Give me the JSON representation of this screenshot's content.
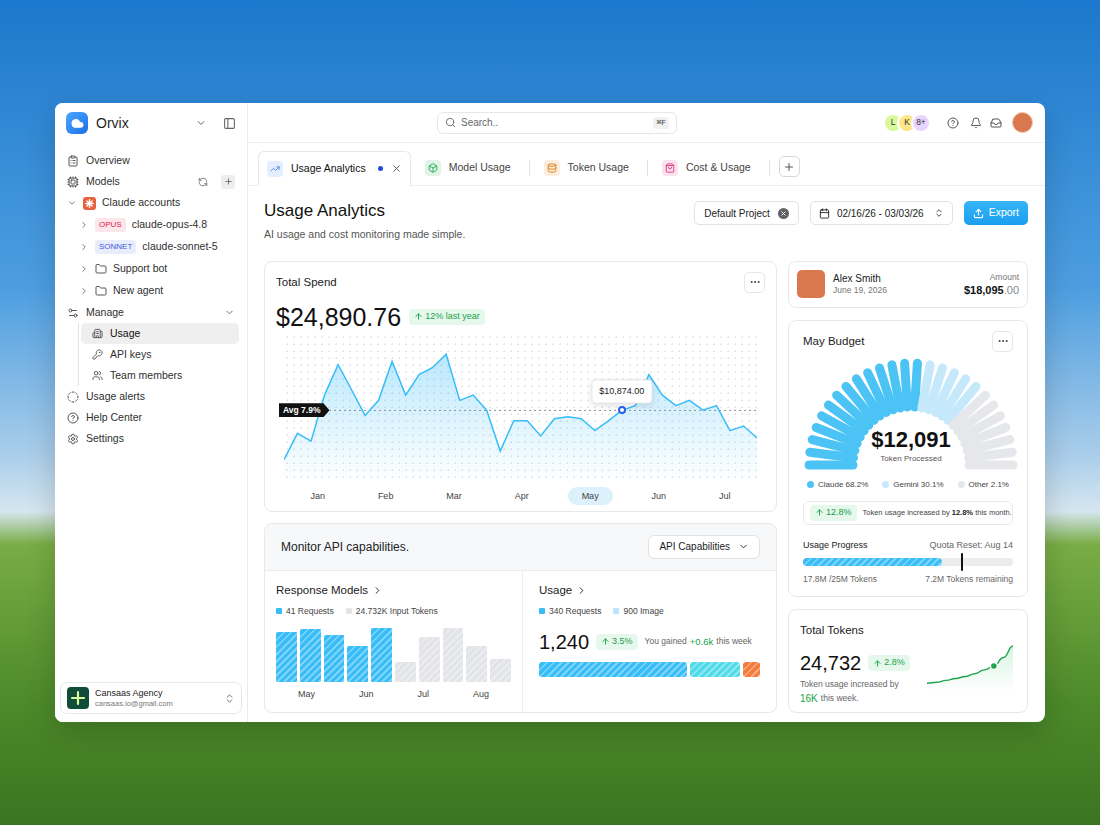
{
  "sidebar": {
    "brand": "Orvix",
    "overview": "Overview",
    "models": {
      "label": "Models",
      "group": {
        "label": "Claude accounts",
        "expanded": true,
        "children": [
          {
            "label": "claude-opus-4.8",
            "kind": "model",
            "badge": "OPUS",
            "color": "#e11d48",
            "expanded": false
          },
          {
            "label": "claude-sonnet-5",
            "kind": "model",
            "badge": "SONNET",
            "color": "#3b5bdb",
            "expanded": false
          },
          {
            "label": "Support bot",
            "kind": "folder",
            "expanded": false
          },
          {
            "label": "New agent",
            "kind": "folder",
            "expanded": false
          }
        ]
      }
    },
    "manage": {
      "label": "Manage",
      "expanded": true,
      "children": [
        {
          "label": "Usage",
          "selected": true
        },
        {
          "label": "API keys",
          "selected": false
        },
        {
          "label": "Team members",
          "selected": false
        }
      ]
    },
    "links": [
      "Usage alerts",
      "Help Center",
      "Settings"
    ],
    "account": {
      "name": "Cansaas Agency",
      "email": "cansaas.io@gmail.com"
    }
  },
  "topbar": {
    "search": {
      "placeholder": "Search..",
      "shortcut": "⌘F"
    },
    "avatars": [
      {
        "label": "L",
        "color": "#d9f99d"
      },
      {
        "label": "K",
        "color": "#fde68a"
      },
      {
        "label": "8+",
        "color": "#e9d5ff"
      }
    ]
  },
  "tabs": [
    {
      "label": "Usage Analytics",
      "selected": true,
      "modified": true,
      "color": "#3b82f6"
    },
    {
      "label": "Model Usage",
      "selected": false,
      "modified": false,
      "color": "#16a34a"
    },
    {
      "label": "Token Usage",
      "selected": false,
      "modified": false,
      "color": "#d97706"
    },
    {
      "label": "Cost & Usage",
      "selected": false,
      "modified": false,
      "color": "#db2777"
    }
  ],
  "page": {
    "title": "Usage Analytics",
    "subtitle": "AI usage and cost monitoring made simple.",
    "project": "Default Project",
    "date_range": "02/16/26 - 03/03/26",
    "export": "Export"
  },
  "total_spend": {
    "title": "Total Spend",
    "amount": "$24,890.76",
    "change": "12% last year",
    "chart": {
      "values": [
        3400,
        7400,
        6200,
        13200,
        17800,
        14000,
        10100,
        12400,
        18300,
        13200,
        16300,
        17400,
        19400,
        12400,
        13200,
        10900,
        4700,
        9300,
        9300,
        7000,
        9600,
        9900,
        9600,
        7800,
        9300,
        10874,
        11600,
        16300,
        13200,
        11600,
        12400,
        10900,
        11600,
        7800,
        8500,
        6700
      ],
      "avg_label": "Avg 7.9%",
      "avg_value": 10874,
      "tooltip": {
        "index": 25,
        "label": "$10,874.00"
      },
      "months": [
        {
          "label": "Jan",
          "selected": false
        },
        {
          "label": "Feb",
          "selected": false
        },
        {
          "label": "Mar",
          "selected": false
        },
        {
          "label": "Apr",
          "selected": false
        },
        {
          "label": "May",
          "selected": true
        },
        {
          "label": "Jun",
          "selected": false
        },
        {
          "label": "Jul",
          "selected": false
        }
      ]
    }
  },
  "monitor": {
    "title": "Monitor API capabilities.",
    "dropdown": "API Capabilities",
    "response_models": {
      "title": "Response Models",
      "series": [
        {
          "label": "41 Requests",
          "color": "#38bdf8",
          "values": [
            50,
            53,
            47,
            36,
            54
          ]
        },
        {
          "label": "24.732K Input Tokens",
          "color": "#e2e4e8",
          "values": [
            20,
            45,
            54,
            36,
            23
          ]
        }
      ],
      "months": [
        "May",
        "Jun",
        "Jul",
        "Aug"
      ]
    },
    "usage": {
      "title": "Usage",
      "legend": [
        {
          "label": "340 Requests",
          "color": "#38bdf8"
        },
        {
          "label": "900 Image",
          "color": "#bae6fd"
        }
      ],
      "value": "1,240",
      "change": "3.5%",
      "note_prefix": "You gained",
      "note_gain": "+0.6k",
      "note_suffix": "this week",
      "segments": [
        {
          "level": 0.68,
          "color": "#38bdf8"
        },
        {
          "level": 0.23,
          "color": "#4fdbe8"
        },
        {
          "level": 0.08,
          "color": "#f47b3a"
        }
      ]
    }
  },
  "transaction": {
    "name": "Alex Smith",
    "date": "June 19, 2026",
    "amount_label": "Amount",
    "amount": "$18,095",
    "amount_cents": ".00"
  },
  "budget": {
    "title": "May Budget",
    "value": "$12,091",
    "caption": "Token Processed",
    "legend": [
      {
        "label": "Claude 68.2%",
        "color": "#4cc3f5",
        "level": 0.52
      },
      {
        "label": "Gemini 30.1%",
        "color": "#c5e9fb",
        "level": 0.2
      },
      {
        "label": "Other 2.1%",
        "color": "#e6e7ea",
        "level": 0.28
      }
    ],
    "change": "12.8%",
    "note_prefix": "Token usage increased by ",
    "note_value": "12.8%",
    "note_suffix": " this month.",
    "progress": {
      "label": "Usage Progress",
      "reset": "Quota Reset: Aug 14",
      "level": 0.66,
      "marker": 0.75,
      "used": "17.8M /25M Tokens",
      "remaining": "7.2M Tokens remaining"
    }
  },
  "total_tokens": {
    "title": "Total Tokens",
    "value": "24,732",
    "change": "2.8%",
    "note": "Token usage increased by",
    "gain": "16K",
    "suffix": "this week.",
    "trend": [
      5,
      6,
      8,
      10,
      12,
      15,
      19,
      23,
      32,
      44
    ],
    "marker_index": 7
  }
}
